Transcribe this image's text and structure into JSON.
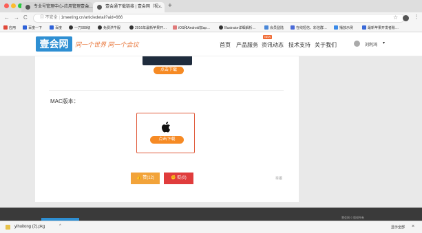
{
  "browser": {
    "tabs": [
      {
        "title": "专业号管理中心-应用管理壹会…",
        "active": false
      },
      {
        "title": "壹会通下载链接 | 壹会网（视…",
        "active": true
      }
    ],
    "tab_close": "×",
    "new_tab": "+",
    "url_security": "不安全",
    "url": "1meeting.cn/articledetail?aid=666",
    "nav": {
      "back": "←",
      "forward": "→",
      "reload": "C"
    },
    "star": "☆"
  },
  "bookmarks": [
    {
      "label": "应用",
      "color": "#e04a3a"
    },
    {
      "label": "百度一下",
      "color": "#2f62d8"
    },
    {
      "label": "百度",
      "color": "#2f62d8"
    },
    {
      "label": "一刀999级",
      "color": "#333333"
    },
    {
      "label": "免费洪牛服",
      "color": "#333333"
    },
    {
      "label": "2016年最新苹果开…",
      "color": "#333333"
    },
    {
      "label": "iOS和Android加ap…",
      "color": "#e07a7a"
    },
    {
      "label": "Illustrator详细解析…",
      "color": "#333333"
    },
    {
      "label": "会员登陆",
      "color": "#4a88d8"
    },
    {
      "label": "在线短信、彩信群…",
      "color": "#4a6ad8"
    },
    {
      "label": "播放示例",
      "color": "#3a8ae8"
    },
    {
      "label": "最新苹果开发者账…",
      "color": "#3a6ad8"
    }
  ],
  "site": {
    "logo": "壹会网",
    "slogan": "同一个世界 同一个会议",
    "nav": [
      "首页",
      "产品服务",
      "资讯动态",
      "技术支持",
      "关于我们"
    ],
    "new_badge": "NEW",
    "username": "刘利鸿",
    "user_arrow": "▾"
  },
  "content": {
    "download_label": "点击下载",
    "mac_heading": "MAC版本：",
    "mac_download_label": "点击下载",
    "like_label": "赞(12)",
    "dislike_label": "贬(0)",
    "report_label": "举报"
  },
  "footer": {
    "text": "壹会网 © 版权所有"
  },
  "download_bar": {
    "filename": "yihuitong (2).pkg",
    "chevron": "^",
    "show_all": "显示全部",
    "close": "×"
  },
  "colors": {
    "brand_blue": "#2e8fd3",
    "download_orange": "#f68a24",
    "like_orange": "#f2a33a",
    "dislike_red": "#e03c3c",
    "mac_border": "#e05a3a"
  }
}
